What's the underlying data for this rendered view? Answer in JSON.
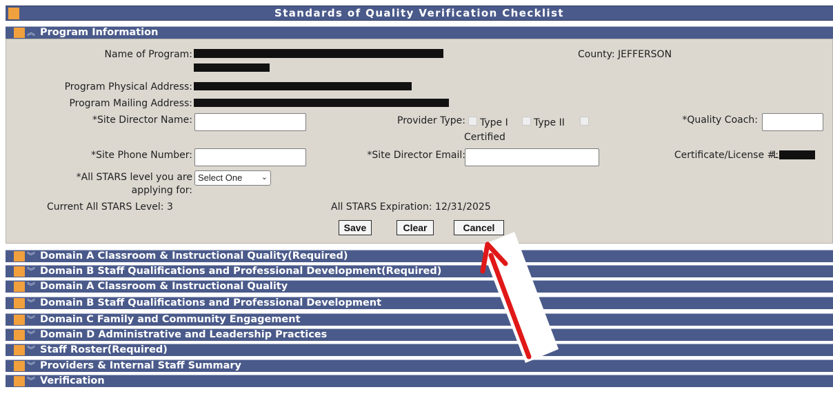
{
  "page": {
    "title": "Standards of Quality Verification Checklist"
  },
  "program_info": {
    "section_label": "Program Information",
    "name_label": "Name of Program:",
    "county_label": "County:",
    "county_value": "JEFFERSON",
    "physical_address_label": "Program Physical Address:",
    "mailing_address_label": "Program Mailing Address:",
    "site_director_name_label": "*Site Director Name:",
    "provider_type_label": "Provider Type:",
    "type1_label": "Type I",
    "type2_label": "Type II",
    "certified_label": "Certified",
    "quality_coach_label": "*Quality Coach:",
    "site_phone_label": "*Site Phone Number:",
    "site_director_email_label": "*Site Director Email:",
    "certificate_label": "Certificate/License #:",
    "certificate_prefix": "L",
    "stars_level_label_1": "*All STARS level you are",
    "stars_level_label_2": "applying for:",
    "stars_select_value": "Select One",
    "current_level_label": "Current All STARS Level:",
    "current_level_value": "3",
    "expiration_label": "All STARS Expiration:",
    "expiration_value": "12/31/2025",
    "save_label": "Save",
    "clear_label": "Clear",
    "cancel_label": "Cancel"
  },
  "sections": [
    "Domain A Classroom & Instructional Quality(Required)",
    "Domain B Staff Qualifications and Professional Development(Required)",
    "Domain A Classroom & Instructional Quality",
    "Domain B Staff Qualifications and Professional Development",
    "Domain C Family and Community Engagement",
    "Domain D Administrative and Leadership Practices",
    "Staff Roster(Required)",
    "Providers & Internal Staff Summary",
    "Verification"
  ],
  "colors": {
    "header_bg": "#4a5a8a",
    "accent_square": "#f1a03e",
    "panel_bg": "#dcd8d0",
    "annotation_arrow": "#e01818"
  },
  "icons": {
    "expanded": "chevron-double-up-icon",
    "collapsed": "chevron-double-down-icon"
  }
}
